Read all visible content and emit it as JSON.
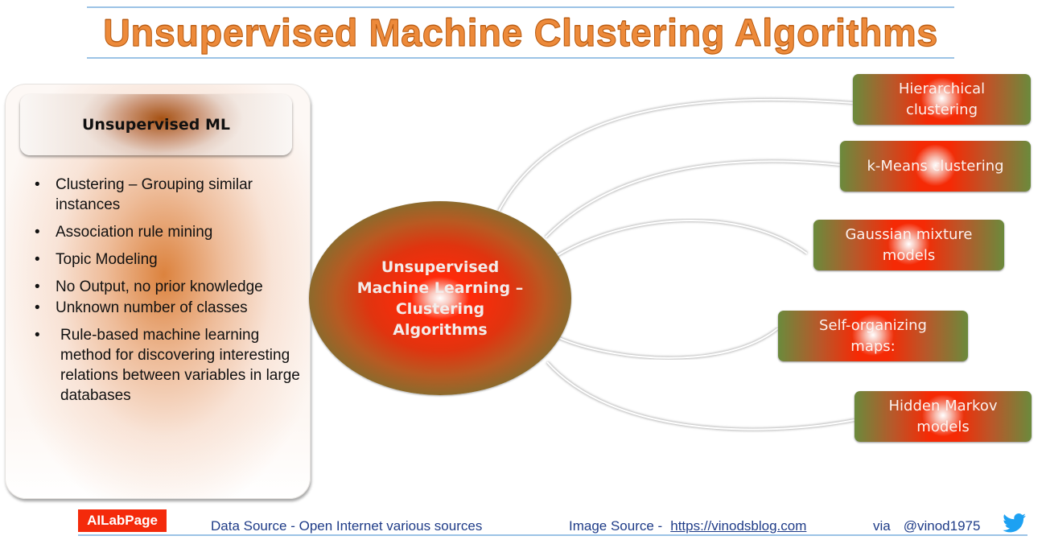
{
  "title": "Unsupervised Machine Clustering Algorithms",
  "left_panel": {
    "header": "Unsupervised ML",
    "bullets": [
      "Clustering – Grouping similar instances",
      "Association rule mining",
      "Topic Modeling",
      "No Output, no prior knowledge",
      "Unknown number of classes",
      "Rule-based machine learning method for discovering interesting relations between variables in large databases"
    ],
    "bullet_glyph": "•"
  },
  "hub": {
    "label": "Unsupervised Machine Learning – Clustering Algorithms"
  },
  "algorithms": [
    {
      "label": "Hierarchical clustering"
    },
    {
      "label": "k-Means clustering"
    },
    {
      "label": "Gaussian mixture models"
    },
    {
      "label": "Self-organizing maps:"
    },
    {
      "label": "Hidden Markov models"
    }
  ],
  "footer": {
    "brand": "AILabPage",
    "data_source_label": "Data Source -  Open Internet  various sources",
    "image_source_label": "Image Source -",
    "image_source_link": "https://vinodsblog.com",
    "via_label": "via",
    "handle": "@vinod1975",
    "social_icon": "twitter-bird-icon"
  },
  "colors": {
    "title_orange": "#ed8a3a",
    "rule_blue": "#9cc3e6",
    "brand_red": "#f42a0b",
    "footer_text_blue": "#1f3c88",
    "twitter_blue": "#1da1f2",
    "box_green": "#6b8a3c",
    "box_red": "#f52a05"
  }
}
